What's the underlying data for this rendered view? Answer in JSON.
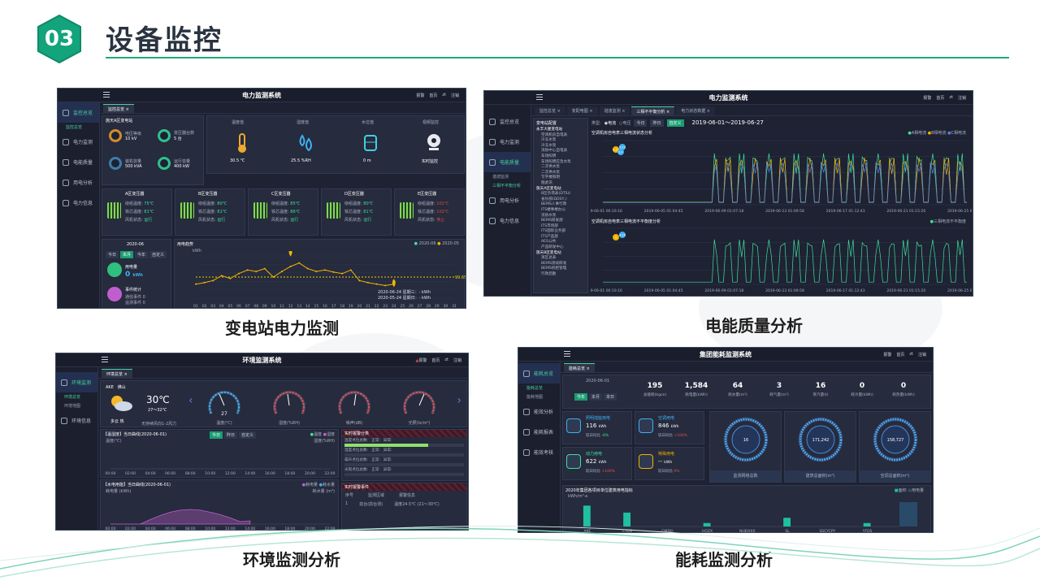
{
  "header": {
    "number": "03",
    "title": "设备监控"
  },
  "colors": {
    "accent": "#1eaa7c",
    "panel_bg": "#1e2233",
    "highlight_green": "#3fe09c",
    "warn_yellow": "#f0b400"
  },
  "panels": {
    "power_station": {
      "system_title": "电力监测系统",
      "top_right": [
        "报警",
        "首页",
        "zt",
        "注销"
      ],
      "sidebar": [
        "监控总览",
        "电力监测",
        "电能质量",
        "用电分析",
        "电力信息"
      ],
      "sidebar_sub": "监控总览",
      "tab": "监控总览",
      "substation_title": "施天A区变电站",
      "stats": [
        {
          "label": "电压等级",
          "value": "10 kV"
        },
        {
          "label": "变压器台数",
          "value": "5 台"
        },
        {
          "label": "装机容量",
          "value": "500 kVA"
        },
        {
          "label": "运行容量",
          "value": "400 kW"
        }
      ],
      "env": [
        {
          "label": "温度值",
          "value": "30.5 ℃"
        },
        {
          "label": "湿度值",
          "value": "25.5 %RH"
        },
        {
          "label": "水位值",
          "value": "0 m"
        },
        {
          "label": "视频监控",
          "value": "实时监控"
        }
      ],
      "transformers": [
        {
          "name": "A区变压器",
          "t1": "75℃",
          "t2": "81℃",
          "state": "运行"
        },
        {
          "name": "B区变压器",
          "t1": "80℃",
          "t2": "81℃",
          "state": "运行"
        },
        {
          "name": "C区变压器",
          "t1": "85℃",
          "t2": "86℃",
          "state": "运行"
        },
        {
          "name": "D区变压器",
          "t1": "80℃",
          "t2": "81℃",
          "state": "运行"
        },
        {
          "name": "E区变压器",
          "t1": "101℃",
          "t2": "102℃",
          "state": "停止"
        }
      ],
      "transformer_labels": [
        "绕组温度:",
        "铁芯温度:",
        "风机状态:"
      ],
      "month": "2020-06",
      "period_buttons": [
        "今日",
        "本月",
        "今年",
        "自定义"
      ],
      "usage_label": "用电量",
      "usage_value": "0",
      "usage_unit": "kWh",
      "event_label": "事件统计",
      "event_lines": [
        "通信事件 0",
        "遥测事件 0"
      ],
      "chart_title": "用电趋势",
      "legend": [
        "2020-06",
        "2020-05"
      ],
      "chart_ylabel": "kWh",
      "chart_avg": "99.65",
      "chart_tooltip": [
        "2020-06-24 星期三：- kWh",
        "2020-05-24 星期日：- kWh"
      ],
      "chart_xticks": [
        "01",
        "02",
        "03",
        "04",
        "05",
        "06",
        "07",
        "08",
        "09",
        "10",
        "11",
        "12",
        "13",
        "14",
        "15",
        "16",
        "17",
        "18",
        "19",
        "20",
        "21",
        "22",
        "23",
        "24",
        "25",
        "26",
        "27",
        "28",
        "29",
        "30",
        "31"
      ]
    },
    "power_quality": {
      "system_title": "电力监测系统",
      "top_right": [
        "报警",
        "首页",
        "zt",
        "注销"
      ],
      "sidebar": [
        "监控总览",
        "电力监测",
        "电能质量",
        "用电分析",
        "电力信息"
      ],
      "sidebar_sub": [
        "谐波监测",
        "三相不平衡分析"
      ],
      "tabs": [
        "监控总览",
        "变配电图",
        "谐波监测",
        "三相不平衡分析",
        "电力状态数据"
      ],
      "tree_title": "变电站配置",
      "tree_items": [
        "永丰大厦变电站",
        "空调机房自电表",
        "冷冻水泵",
        "冷冻水泵",
        "消防中心自电表",
        "车场照明",
        "车场照明应急水泵",
        "二次供水泵",
        "二次供水泵",
        "写字楼照明",
        "施武讯",
        "施天A区变电站",
        "B区负荷表(DTSU",
        "省份部(DDSY,)",
        "BEMS人事行政",
        "ITS楼事楼办公",
        "消防水泵",
        "BEMS研发部",
        "ITS市场部",
        "ITS国际业务部",
        "ITS产品部",
        "AES公共",
        "产品研发中心",
        "施天B区变电站",
        "演区总表",
        "BEMS测试研发",
        "BEMS机柜管理",
        "行政后勤"
      ],
      "type_label": "类型:",
      "type_options": [
        "电流",
        "电压"
      ],
      "period_buttons": [
        "今日",
        "昨日",
        "自定义"
      ],
      "date_range": "2019-06-01～2019-06-27",
      "chart1_title": "空调机房自电表三相电流状态分析",
      "chart1_legend": [
        "A相电流",
        "B相电流",
        "C相电流"
      ],
      "chart1_marks": [
        "8.13",
        "0.16",
        "0.1"
      ],
      "chart2_title": "空调机房自电表三相电流不平衡度分析",
      "chart2_legend": [
        "三相电流不平衡度"
      ],
      "chart2_marks": [
        "8.18",
        "0"
      ],
      "xticks": [
        "2019-06-01 00:10:16",
        "2019-06-05 01:04:45",
        "2019-06-09 01:07:18",
        "2019-06-13 01:09:58",
        "2019-06-17 01:12:43",
        "2019-06-21 01:15:20",
        "2019-06-25 01:18:06"
      ]
    },
    "environment": {
      "system_title": "环境监测系统",
      "top_right": [
        "报警",
        "首页",
        "zt",
        "注销"
      ],
      "sidebar": [
        "环境监测",
        "环境信息"
      ],
      "sidebar_sub": [
        "环境总览",
        "环境地图"
      ],
      "tab": "环境总览",
      "station": "AKE",
      "city": "佛山",
      "weather_temp": "30℃",
      "weather_range": "27～32℃",
      "weather_text": "多云 热",
      "weather_wind": "无持续风向1-2风力",
      "gauges": [
        {
          "label": "温度(℃)",
          "value": "27"
        },
        {
          "label": "湿度(%RH)",
          "value": ""
        },
        {
          "label": "噪声(dB)",
          "value": ""
        },
        {
          "label": "光照(lx/m²)",
          "value": ""
        }
      ],
      "chart1_title": "【温湿度】当日曲线(2020-06-01)",
      "chart1_buttons": [
        "今日",
        "昨日",
        "自定义"
      ],
      "chart1_legend": [
        "温度",
        "湿度"
      ],
      "chart1_yleft": "温度(℃)",
      "chart1_yright": "湿度(%RH)",
      "chart2_title": "【水电用能】当日曲线(2020-06-01)",
      "chart2_legend": [
        "耗电量",
        "耗水量"
      ],
      "chart2_yleft": "耗电量 (kWh)",
      "chart2_yright": "耗水量 (m³)",
      "xticks": [
        "00:00",
        "02:00",
        "04:00",
        "06:00",
        "08:00",
        "10:00",
        "12:00",
        "14:00",
        "16:00",
        "18:00",
        "20:00",
        "22:00"
      ],
      "alarm_title": "实时报警分类",
      "alarm_rows": [
        {
          "label": "温度点位总数:",
          "normal": "正常:",
          "abnormal": "异常:"
        },
        {
          "label": "湿度点位总数:",
          "normal": "正常:",
          "abnormal": "异常:"
        },
        {
          "label": "噪声点位总数:",
          "normal": "正常:",
          "abnormal": "异常:"
        },
        {
          "label": "光照点位总数:",
          "normal": "正常:",
          "abnormal": "异常:"
        }
      ],
      "event_title": "实时报警事件",
      "event_headers": [
        "序号",
        "监测区域",
        "报警信息"
      ],
      "event_row": [
        "1",
        "前台(前台测)",
        "温度24.5℃ (21～30℃)"
      ]
    },
    "energy": {
      "system_title": "集团能耗监测系统",
      "top_right": [
        "报警",
        "首页",
        "zt",
        "注销"
      ],
      "sidebar": [
        "能耗总览",
        "能效分析",
        "能耗报表",
        "能效考核"
      ],
      "sidebar_sub": [
        "能耗总览",
        "能耗地图"
      ],
      "tab": "能耗总览",
      "date": "2020-06-01",
      "period_buttons": [
        "今年",
        "本月",
        "本日"
      ],
      "kpis": [
        {
          "value": "195",
          "label": "总能耗(kgce)"
        },
        {
          "value": "1,584",
          "label": "耗电量(kWh)"
        },
        {
          "value": "64",
          "label": "耗水量(m³)"
        },
        {
          "value": "3",
          "label": "耗气量(m³)"
        },
        {
          "value": "16",
          "label": "蒸汽量(t)"
        },
        {
          "value": "0",
          "label": "耗冷量(kWh)"
        },
        {
          "value": "0",
          "label": "耗热量(kWh)"
        }
      ],
      "cards": [
        {
          "title": "照明插座用电",
          "value": "116",
          "unit": "kWh",
          "delta": "-8%"
        },
        {
          "title": "空调用电",
          "value": "846",
          "unit": "kWh",
          "delta": "+100%"
        },
        {
          "title": "动力用电",
          "value": "622",
          "unit": "kWh",
          "delta": "+100%"
        },
        {
          "title": "特殊用电",
          "value": "--",
          "unit": "kWh",
          "delta": "0%"
        }
      ],
      "card_label": "较日同比",
      "rings": [
        {
          "value": "16",
          "label": "监测网络总数"
        },
        {
          "value": "171,242",
          "label": "建筑总面积(m²)"
        },
        {
          "value": "158,727",
          "label": "空调总面积(m²)"
        }
      ],
      "bar_title": "2020年集团各项目单位建筑用电指标",
      "bar_legend": [
        "面积",
        "用电量"
      ],
      "bar_ylabel": "kWh/m²·a",
      "bar_categories": [
        "AKE",
        "CYDS",
        "GMSKI",
        "HQZX",
        "NHDXXX",
        "SL",
        "SSCYCPY",
        "YFDS"
      ]
    }
  },
  "captions": [
    "变电站电力监测",
    "电能质量分析",
    "环境监测分析",
    "能耗监测分析"
  ],
  "chart_data": [
    {
      "type": "line",
      "title": "用电趋势",
      "ylabel": "kWh",
      "categories": [
        "01",
        "02",
        "03",
        "04",
        "05",
        "06",
        "07",
        "08",
        "09",
        "10",
        "11",
        "12",
        "13",
        "14",
        "15",
        "16",
        "17",
        "18",
        "19",
        "20",
        "21",
        "22",
        "23",
        "24",
        "25",
        "26",
        "27",
        "28",
        "29",
        "30",
        "31"
      ],
      "series": [
        {
          "name": "2020-06",
          "values": [
            40,
            42,
            45,
            52,
            48,
            55,
            60,
            58,
            62,
            50,
            58,
            65,
            70,
            62,
            58,
            60,
            57,
            55,
            60,
            45,
            42,
            40,
            38,
            40,
            null,
            null,
            null,
            null,
            null,
            null,
            null
          ]
        },
        {
          "name": "2020-05",
          "values": []
        }
      ]
    },
    {
      "type": "bar",
      "title": "2020年集团各项目单位建筑用电指标",
      "ylabel": "kWh/m²·a",
      "categories": [
        "AKE",
        "CYDS",
        "GMSKI",
        "HQZX",
        "NHDXXX",
        "SL",
        "SSCYCPY",
        "YFDS"
      ],
      "values": [
        6,
        4,
        0,
        1,
        0,
        2.5,
        0,
        1
      ]
    }
  ]
}
